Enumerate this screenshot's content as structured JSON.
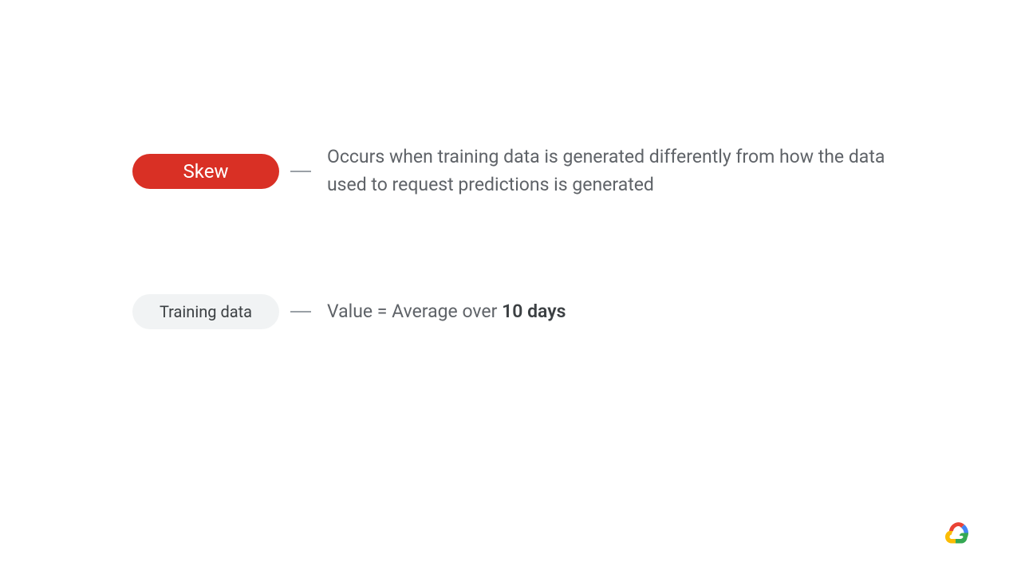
{
  "rows": [
    {
      "pill": {
        "label": "Skew",
        "style": "red"
      },
      "description": {
        "text": "Occurs when training data is generated differently from how the data used to request predictions is generated"
      }
    },
    {
      "pill": {
        "label": "Training data",
        "style": "gray"
      },
      "description": {
        "prefix": "Value = Average over ",
        "bold": "10 days"
      }
    }
  ]
}
